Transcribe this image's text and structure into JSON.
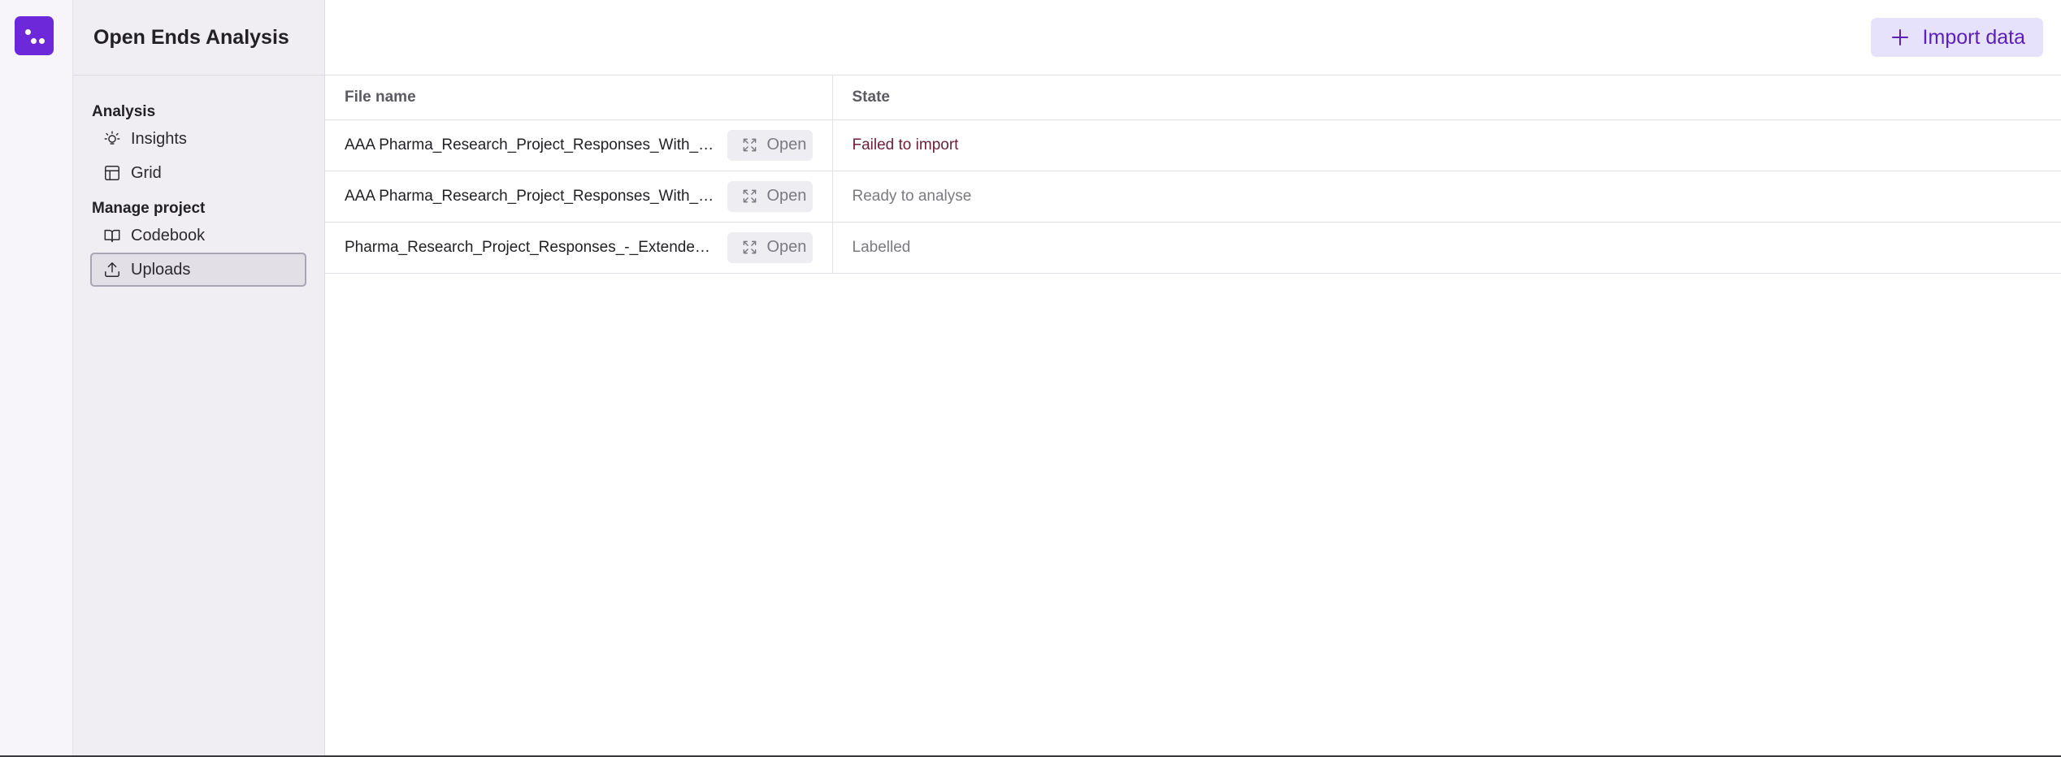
{
  "sidebar": {
    "project_title": "Open Ends Analysis",
    "sections": [
      {
        "title": "Analysis",
        "items": [
          {
            "label": "Insights",
            "icon": "lightbulb-icon"
          },
          {
            "label": "Grid",
            "icon": "table-icon"
          }
        ]
      },
      {
        "title": "Manage project",
        "items": [
          {
            "label": "Codebook",
            "icon": "book-icon"
          },
          {
            "label": "Uploads",
            "icon": "upload-icon",
            "active": true
          }
        ]
      }
    ]
  },
  "header": {
    "import_label": "Import data"
  },
  "table": {
    "columns": [
      "File name",
      "State"
    ],
    "rows": [
      {
        "file": "AAA Pharma_Research_Project_Responses_With_Extended_Codes.xlsx",
        "open_label": "Open",
        "state": "Failed to import"
      },
      {
        "file": "AAA Pharma_Research_Project_Responses_With_Extended_Codes.xlsx",
        "open_label": "Open",
        "state": "Ready to analyse"
      },
      {
        "file": "Pharma_Research_Project_Responses_-_Extended.xlsx",
        "open_label": "Open",
        "state": "Labelled"
      }
    ]
  },
  "colors": {
    "accent": "#6d28d9",
    "import_bg": "#e7e2fb",
    "failed": "#6b1f3a"
  }
}
